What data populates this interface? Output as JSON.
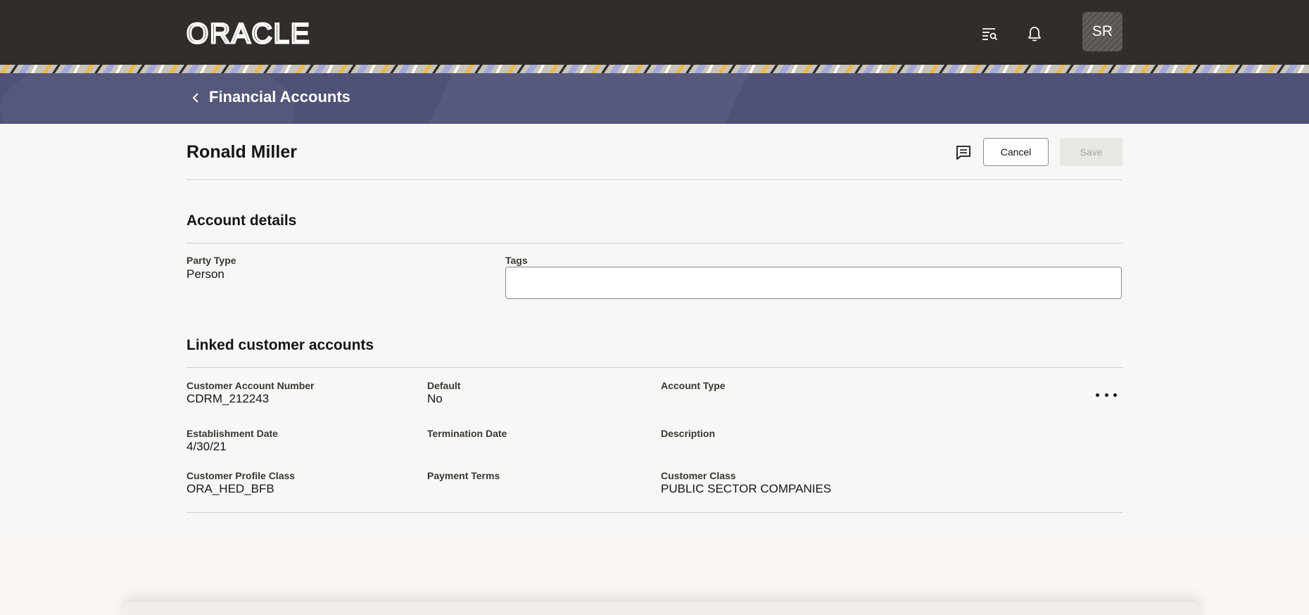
{
  "header": {
    "logo_text": "ORACLE",
    "icons": [
      "search-list-icon",
      "bell-icon"
    ],
    "avatar_initials": "SR"
  },
  "page": {
    "title": "Financial Accounts",
    "record_name": "Ronald Miller",
    "actions": {
      "cancel_label": "Cancel",
      "save_label": "Save"
    }
  },
  "account_details": {
    "title": "Account details",
    "party_type_label": "Party Type",
    "party_type_value": "Person",
    "tags_label": "Tags",
    "tags_value": ""
  },
  "linked_accounts": {
    "title": "Linked customer accounts",
    "fields": {
      "account_number_label": "Customer Account Number",
      "account_number_value": "CDRM_212243",
      "default_label": "Default",
      "default_value": "No",
      "account_type_label": "Account Type",
      "account_type_value": "",
      "establishment_date_label": "Establishment Date",
      "establishment_date_value": "4/30/21",
      "termination_date_label": "Termination Date",
      "termination_date_value": "",
      "description_label": "Description",
      "description_value": "",
      "profile_class_label": "Customer Profile Class",
      "profile_class_value": "ORA_HED_BFB",
      "payment_terms_label": "Payment Terms",
      "payment_terms_value": "",
      "customer_class_label": "Customer Class",
      "customer_class_value": "PUBLIC SECTOR COMPANIES"
    }
  },
  "colors": {
    "header_bg": "#312d2a",
    "title_band_bg": "#4f5276",
    "page_bg": "#f8f7f5"
  }
}
